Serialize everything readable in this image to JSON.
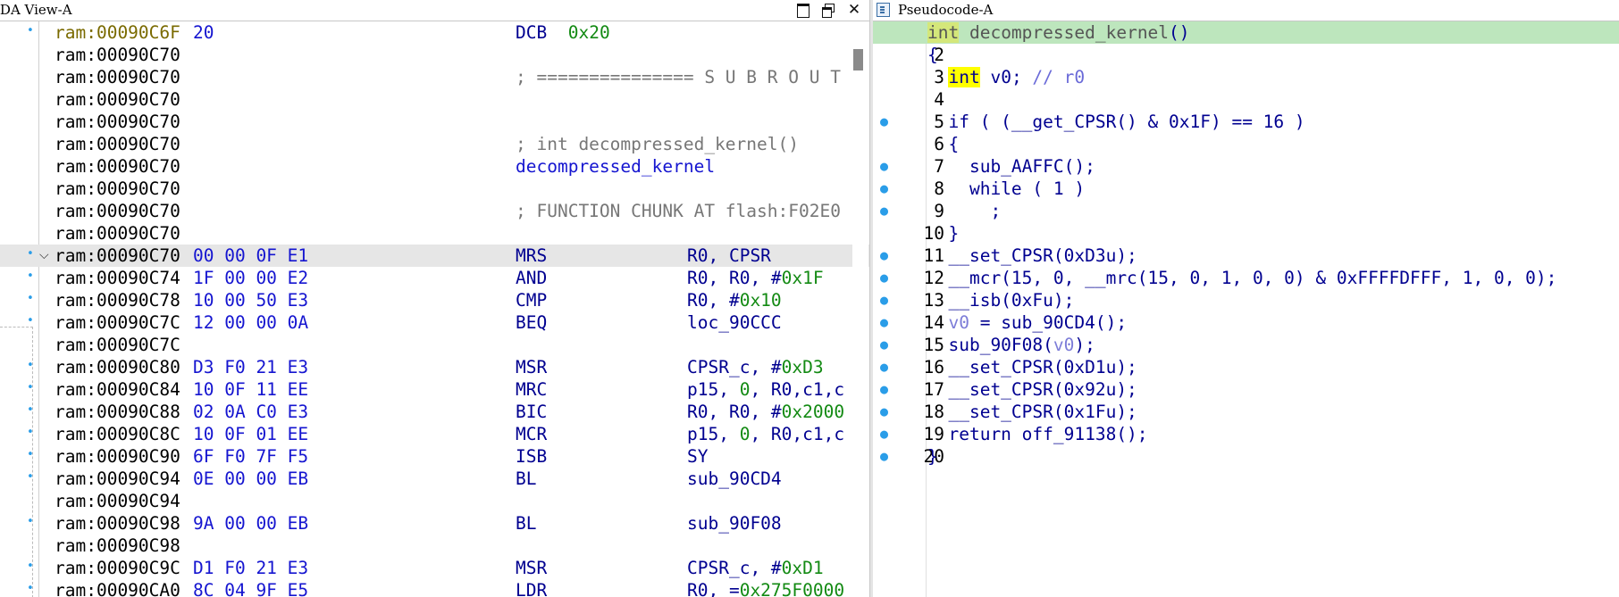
{
  "left_pane": {
    "title": "IDA View-A",
    "buttons": {
      "maximize": "maximize",
      "restore": "restore",
      "close": "✕"
    },
    "rows": [
      {
        "dot": true,
        "addr": "ram:00090C6F",
        "bytes": "20",
        "mnem": "DCB",
        "ops_plain": "",
        "ops_hex": "0x20",
        "mnem_kind": "mnem-hex"
      },
      {
        "addr": "ram:00090C70"
      },
      {
        "addr": "ram:00090C70",
        "mnem": "; =============== S U B R O U T",
        "mnem_kind": "comment"
      },
      {
        "addr": "ram:00090C70"
      },
      {
        "addr": "ram:00090C70"
      },
      {
        "addr": "ram:00090C70",
        "mnem": "; int decompressed_kernel()",
        "mnem_kind": "comment"
      },
      {
        "addr": "ram:00090C70",
        "mnem": "decompressed_kernel",
        "mnem_kind": "label"
      },
      {
        "addr": "ram:00090C70"
      },
      {
        "addr": "ram:00090C70",
        "mnem": "; FUNCTION CHUNK AT flash:F02E0",
        "mnem_kind": "comment"
      },
      {
        "addr": "ram:00090C70"
      },
      {
        "dot": true,
        "chev": true,
        "hl": true,
        "addr": "ram:00090C70",
        "bytes": "00 00 0F E1",
        "mnem": "MRS",
        "ops_plain": "R0, CPSR",
        "ops_hex": ""
      },
      {
        "dot": true,
        "addr": "ram:00090C74",
        "bytes": "1F 00 00 E2",
        "mnem": "AND",
        "ops_plain": "R0, R0, #",
        "ops_hex": "0x1F"
      },
      {
        "dot": true,
        "addr": "ram:00090C78",
        "bytes": "10 00 50 E3",
        "mnem": "CMP",
        "ops_plain": "R0, #",
        "ops_hex": "0x10"
      },
      {
        "dot": true,
        "addr": "ram:00090C7C",
        "bytes": "12 00 00 0A",
        "mnem": "BEQ",
        "ops_plain": "loc_90CCC",
        "ops_hex": ""
      },
      {
        "addr": "ram:00090C7C"
      },
      {
        "dot": true,
        "addr": "ram:00090C80",
        "bytes": "D3 F0 21 E3",
        "mnem": "MSR",
        "ops_plain": "CPSR_c, #",
        "ops_hex": "0xD3"
      },
      {
        "dot": true,
        "addr": "ram:00090C84",
        "bytes": "10 0F 11 EE",
        "mnem": "MRC",
        "ops_plain": "p15, ",
        "ops_hex": "0",
        "ops_tail": ", R0,c1,c"
      },
      {
        "dot": true,
        "addr": "ram:00090C88",
        "bytes": "02 0A C0 E3",
        "mnem": "BIC",
        "ops_plain": "R0, R0, #",
        "ops_hex": "0x2000"
      },
      {
        "dot": true,
        "addr": "ram:00090C8C",
        "bytes": "10 0F 01 EE",
        "mnem": "MCR",
        "ops_plain": "p15, ",
        "ops_hex": "0",
        "ops_tail": ", R0,c1,c"
      },
      {
        "dot": true,
        "addr": "ram:00090C90",
        "bytes": "6F F0 7F F5",
        "mnem": "ISB",
        "ops_plain": "SY",
        "ops_hex": ""
      },
      {
        "dot": true,
        "addr": "ram:00090C94",
        "bytes": "0E 00 00 EB",
        "mnem": "BL",
        "ops_plain": "sub_90CD4",
        "ops_hex": ""
      },
      {
        "addr": "ram:00090C94"
      },
      {
        "dot": true,
        "addr": "ram:00090C98",
        "bytes": "9A 00 00 EB",
        "mnem": "BL",
        "ops_plain": "sub_90F08",
        "ops_hex": ""
      },
      {
        "addr": "ram:00090C98"
      },
      {
        "dot": true,
        "addr": "ram:00090C9C",
        "bytes": "D1 F0 21 E3",
        "mnem": "MSR",
        "ops_plain": "CPSR_c, #",
        "ops_hex": "0xD1"
      },
      {
        "dot": true,
        "addr": "ram:00090CA0",
        "bytes": "8C 04 9F E5",
        "mnem": "LDR",
        "ops_plain": "R0, =",
        "ops_hex": "0x275F0000"
      }
    ]
  },
  "right_pane": {
    "title": "Pseudocode-A",
    "lines": [
      {
        "n": "1",
        "hl": true,
        "segs": [
          [
            "first-type",
            "int"
          ],
          [
            "gray",
            " decompressed_kernel"
          ],
          [
            "",
            "()"
          ]
        ]
      },
      {
        "n": "2",
        "segs": [
          [
            "",
            "{"
          ]
        ]
      },
      {
        "n": "3",
        "segs": [
          [
            "",
            "  "
          ],
          [
            "kw-type",
            "int"
          ],
          [
            "",
            " v0; "
          ],
          [
            "cmt",
            "// r0"
          ]
        ]
      },
      {
        "n": "4",
        "segs": []
      },
      {
        "n": "5",
        "dot": true,
        "segs": [
          [
            "",
            "  if ( (__get_CPSR() & 0x1F) == 16 )"
          ]
        ]
      },
      {
        "n": "6",
        "segs": [
          [
            "",
            "  {"
          ]
        ]
      },
      {
        "n": "7",
        "dot": true,
        "segs": [
          [
            "",
            "    sub_AAFFC();"
          ]
        ]
      },
      {
        "n": "8",
        "dot": true,
        "segs": [
          [
            "",
            "    while ( 1 )"
          ]
        ]
      },
      {
        "n": "9",
        "dot": true,
        "segs": [
          [
            "",
            "      ;"
          ]
        ]
      },
      {
        "n": "10",
        "segs": [
          [
            "",
            "  }"
          ]
        ]
      },
      {
        "n": "11",
        "dot": true,
        "segs": [
          [
            "",
            "  __set_CPSR(0xD3u);"
          ]
        ]
      },
      {
        "n": "12",
        "dot": true,
        "segs": [
          [
            "",
            "  __mcr(15, 0, __mrc(15, 0, 1, 0, 0) & 0xFFFFDFFF, 1, 0, 0);"
          ]
        ]
      },
      {
        "n": "13",
        "dot": true,
        "segs": [
          [
            "",
            "  __isb(0xFu);"
          ]
        ]
      },
      {
        "n": "14",
        "dot": true,
        "segs": [
          [
            "",
            "  "
          ],
          [
            "var",
            "v0"
          ],
          [
            "",
            " = sub_90CD4();"
          ]
        ]
      },
      {
        "n": "15",
        "dot": true,
        "segs": [
          [
            "",
            "  sub_90F08("
          ],
          [
            "var",
            "v0"
          ],
          [
            "",
            ");"
          ]
        ]
      },
      {
        "n": "16",
        "dot": true,
        "segs": [
          [
            "",
            "  __set_CPSR(0xD1u);"
          ]
        ]
      },
      {
        "n": "17",
        "dot": true,
        "segs": [
          [
            "",
            "  __set_CPSR(0x92u);"
          ]
        ]
      },
      {
        "n": "18",
        "dot": true,
        "segs": [
          [
            "",
            "  __set_CPSR(0x1Fu);"
          ]
        ]
      },
      {
        "n": "19",
        "dot": true,
        "segs": [
          [
            "",
            "  return off_91138();"
          ]
        ]
      },
      {
        "n": "20",
        "dot": true,
        "segs": [
          [
            "",
            "}"
          ]
        ]
      }
    ]
  }
}
